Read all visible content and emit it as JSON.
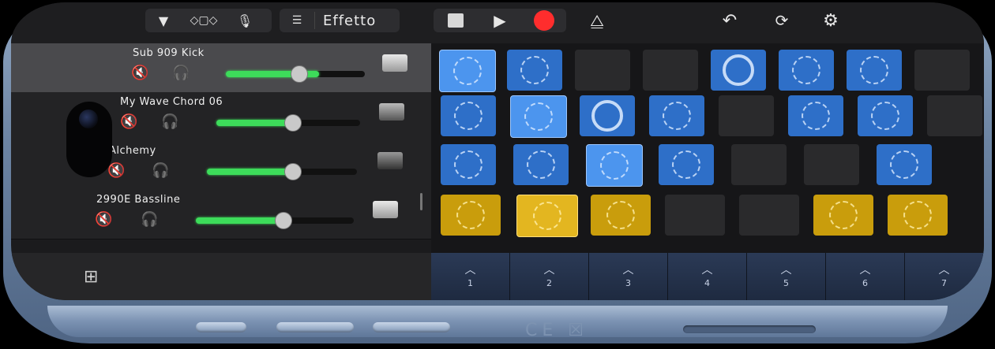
{
  "toolbar": {
    "effects_label": "Effetto",
    "left_icons": [
      "dropdown-triangle-icon",
      "view-toggle-icon",
      "microphone-icon",
      "mixer-sliders-icon"
    ],
    "transport": [
      "stop-icon",
      "play-icon",
      "record-icon"
    ],
    "metronome": "metronome-icon",
    "right_icons": [
      "undo-icon",
      "loop-icon",
      "settings-gear-icon"
    ]
  },
  "tracks": [
    {
      "name": "Sub 909 Kick",
      "volume": 0.7,
      "selected": true
    },
    {
      "name": "My Wave Chord 06",
      "volume": 0.52,
      "selected": false
    },
    {
      "name": "Alchemy",
      "volume": 0.58,
      "selected": false
    },
    {
      "name": "2990E Bassline",
      "volume": 0.6,
      "selected": false
    }
  ],
  "columns": [
    "1",
    "2",
    "3",
    "4",
    "5",
    "6",
    "7"
  ],
  "colors": {
    "accent_blue": "#2e6fc8",
    "accent_yellow": "#c99d0c",
    "record_red": "#ff2d2d",
    "volume_green": "#3ddc5a"
  }
}
